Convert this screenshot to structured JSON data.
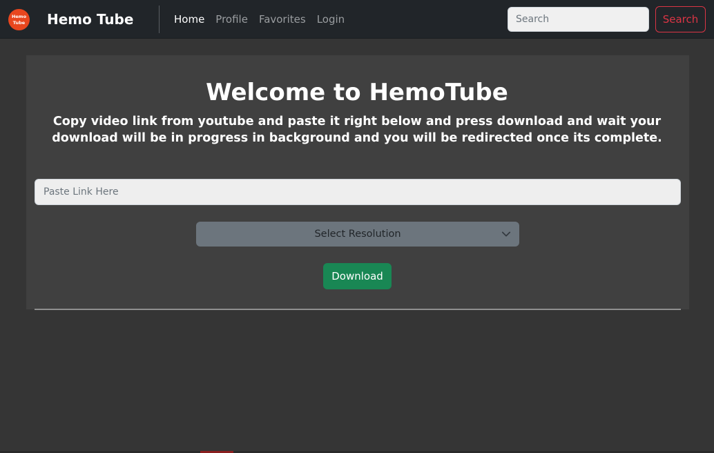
{
  "navbar": {
    "logo_line1": "Hemo",
    "logo_line2": "Tube",
    "brand": "Hemo Tube",
    "links": [
      {
        "label": "Home",
        "active": true
      },
      {
        "label": "Profile",
        "active": false
      },
      {
        "label": "Favorites",
        "active": false
      },
      {
        "label": "Login",
        "active": false
      }
    ],
    "search_placeholder": "Search",
    "search_button": "Search"
  },
  "main": {
    "title": "Welcome to HemoTube",
    "subtitle": "Copy video link from youtube and paste it right below and press download and wait your download will be in progress in background and you will be redirected once its complete.",
    "link_placeholder": "Paste Link Here",
    "resolution_select": "Select Resolution",
    "download_button": "Download"
  },
  "colors": {
    "navbar_bg": "#212529",
    "page_bg": "#353535",
    "card_bg": "#404040",
    "logo": "#e8461e",
    "search_button": "#dc3545",
    "download_button": "#198754",
    "select_bg": "#6c757d"
  },
  "icons": {
    "logo": "hemo-tube-logo",
    "select_arrow": "chevron-down-icon"
  }
}
